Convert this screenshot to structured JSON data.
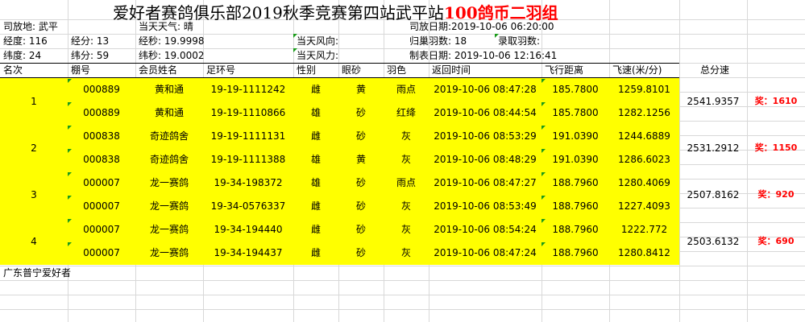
{
  "title": {
    "part1": "爱好者赛鸽俱乐部2019秋季竞赛第四站武平站",
    "part2": "100鸽币二羽组"
  },
  "info": {
    "release_place": "司放地: 武平",
    "weather": "当天天气: 晴",
    "release_date": "司放日期:2019-10-06 06:20:00",
    "longitude_deg": "经度: 116",
    "longitude_min": "经分: 13",
    "longitude_sec": "经秒: 19.9998",
    "wind_dir": "当天风向:",
    "homing_count": "归巢羽数: 18",
    "recorded_count": "录取羽数:",
    "latitude_deg": "纬度:  24",
    "latitude_min": "纬分: 59",
    "latitude_sec": "纬秒: 19.0002",
    "wind_force": "当天风力:",
    "table_date": "制表日期: 2019-10-06 12:16:41"
  },
  "headers": [
    "名次",
    "棚号",
    "会员姓名",
    "足环号",
    "性别",
    "眼砂",
    "羽色",
    "返回时间",
    "飞行距离",
    "飞速(米/分)",
    "总分速"
  ],
  "groups": [
    {
      "rank": "1",
      "total": "2541.9357",
      "prize": "奖：1610",
      "rows": [
        {
          "loft": "000889",
          "member": "黄和通",
          "ring": "19-19-1111242",
          "sex": "雌",
          "eye": "黄",
          "color": "雨点",
          "time": "2019-10-06 08:47:28",
          "distance": "185.7800",
          "speed": "1259.8101"
        },
        {
          "loft": "000889",
          "member": "黄和通",
          "ring": "19-19-1110866",
          "sex": "雄",
          "eye": "砂",
          "color": "红绛",
          "time": "2019-10-06 08:44:54",
          "distance": "185.7800",
          "speed": "1282.1256"
        }
      ]
    },
    {
      "rank": "2",
      "total": "2531.2912",
      "prize": "奖：1150",
      "rows": [
        {
          "loft": "000838",
          "member": "奇迹鸽舍",
          "ring": "19-19-1111131",
          "sex": "雌",
          "eye": "砂",
          "color": "灰",
          "time": "2019-10-06 08:53:29",
          "distance": "191.0390",
          "speed": "1244.6889"
        },
        {
          "loft": "000838",
          "member": "奇迹鸽舍",
          "ring": "19-19-1111388",
          "sex": "雄",
          "eye": "黄",
          "color": "灰",
          "time": "2019-10-06 08:48:29",
          "distance": "191.0390",
          "speed": "1286.6023"
        }
      ]
    },
    {
      "rank": "3",
      "total": "2507.8162",
      "prize": "奖：920",
      "rows": [
        {
          "loft": "000007",
          "member": "龙一赛鸽",
          "ring": "19-34-198372",
          "sex": "雄",
          "eye": "砂",
          "color": "雨点",
          "time": "2019-10-06 08:47:27",
          "distance": "188.7960",
          "speed": "1280.4069"
        },
        {
          "loft": "000007",
          "member": "龙一赛鸽",
          "ring": "19-34-0576337",
          "sex": "雌",
          "eye": "砂",
          "color": "灰",
          "time": "2019-10-06 08:53:49",
          "distance": "188.7960",
          "speed": "1227.4093"
        }
      ]
    },
    {
      "rank": "4",
      "total": "2503.6132",
      "prize": "奖：690",
      "rows": [
        {
          "loft": "000007",
          "member": "龙一赛鸽",
          "ring": "19-34-194440",
          "sex": "雌",
          "eye": "砂",
          "color": "灰",
          "time": "2019-10-06 08:54:24",
          "distance": "188.7960",
          "speed": "1222.772"
        },
        {
          "loft": "000007",
          "member": "龙一赛鸽",
          "ring": "19-34-194437",
          "sex": "雌",
          "eye": "砂",
          "color": "灰",
          "time": "2019-10-06 08:47:24",
          "distance": "188.7960",
          "speed": "1280.8412"
        }
      ]
    }
  ],
  "footer": "广东普宁爱好者",
  "colors": {
    "highlight": "#ffff00",
    "prize_text": "#ff0000",
    "title_accent": "#ff0000"
  }
}
